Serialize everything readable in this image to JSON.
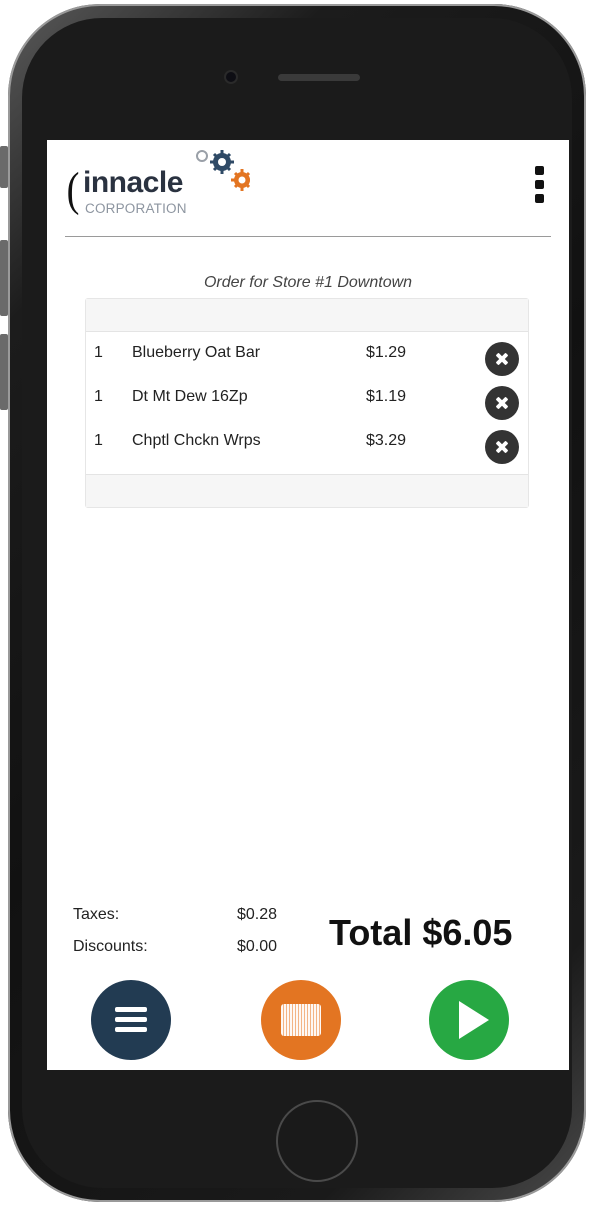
{
  "app": {
    "logo_text": "innacle",
    "logo_subtext": "CORPORATION"
  },
  "order": {
    "title": "Order for Store #1 Downtown",
    "items": [
      {
        "qty": "1",
        "name": "Blueberry Oat Bar",
        "price": "$1.29"
      },
      {
        "qty": "1",
        "name": "Dt Mt Dew 16Zp",
        "price": "$1.19"
      },
      {
        "qty": "1",
        "name": "Chptl Chckn Wrps",
        "price": "$3.29"
      }
    ]
  },
  "summary": {
    "taxes_label": "Taxes:",
    "taxes_value": "$0.28",
    "discounts_label": "Discounts:",
    "discounts_value": "$0.00",
    "total_text": "Total $6.05"
  },
  "icons": {
    "menu": "kebab-menu-icon",
    "remove": "remove-circle-x-icon",
    "list": "hamburger-icon",
    "scan": "barcode-icon",
    "proceed": "play-icon"
  },
  "colors": {
    "menu_button": "#223b52",
    "scan_button": "#e37522",
    "proceed_button": "#27a843",
    "logo_gear_blue": "#2f4a66",
    "logo_gear_orange": "#e37522"
  }
}
